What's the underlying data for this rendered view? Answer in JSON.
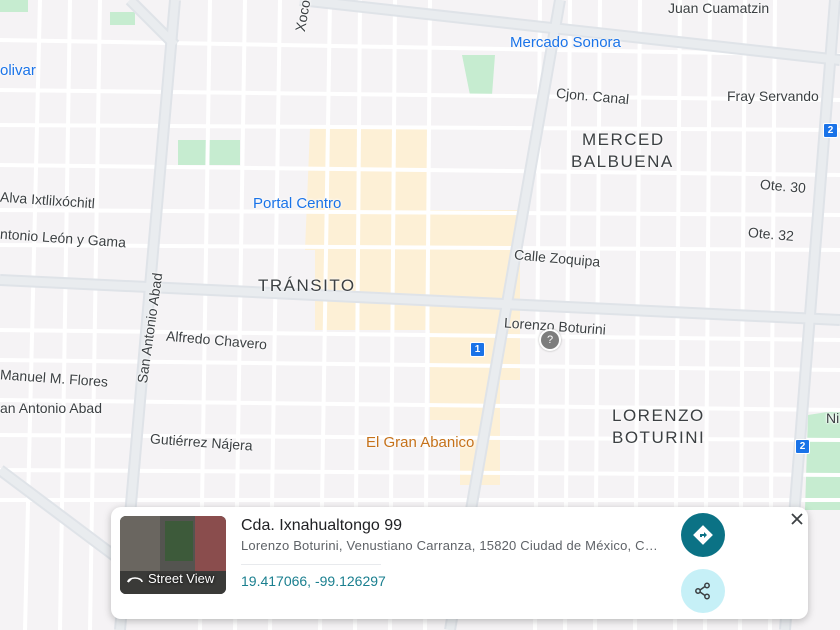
{
  "map": {
    "districts": [
      "TRÁNSITO",
      "MERCED",
      "BALBUENA",
      "LORENZO",
      "BOTURINI"
    ],
    "pois": [
      "Mercado Sonora",
      "Portal Centro",
      "El Gran Abanico"
    ],
    "streets": [
      "Juan Cuamatzin",
      "Xocongo",
      "Cjon. Canal",
      "Fray Servando",
      "Ote. 30",
      "Ote. 32",
      "Calle Zoquipa",
      "Lorenzo Boturini",
      "San Antonio Abad",
      "Alfredo Chavero",
      "Manuel M. Flores",
      "an Antonio Abad",
      "Gutiérrez Nájera",
      "Alva Ixtlilxóchitl",
      "ntonio León y Gama",
      "olivar",
      "Ni"
    ],
    "route_shields": [
      "1",
      "2",
      "2"
    ],
    "colors": {
      "background": "#f5f3f5",
      "road": "#ffffff",
      "highlight": "#fdf0d6",
      "park": "#c6ecd0",
      "accent": "#1a73e8"
    }
  },
  "card": {
    "street_view_label": "Street View",
    "title": "Cda. Ixnahualtongo 99",
    "address": "Lorenzo Boturini, Venustiano Carranza, 15820 Ciudad de México, C…",
    "coordinates": "19.417066, -99.126297",
    "directions_icon": "directions-icon",
    "share_icon": "share-icon",
    "close_icon": "close-icon"
  }
}
